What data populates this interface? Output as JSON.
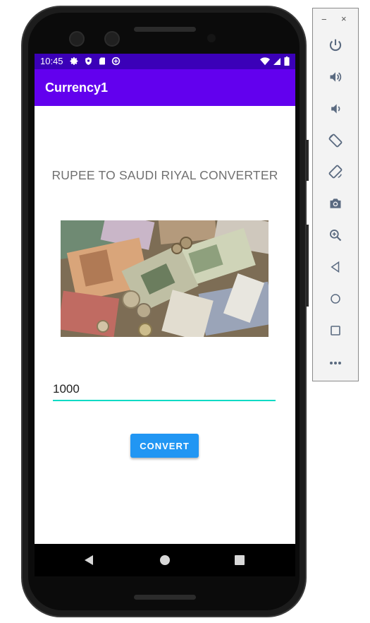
{
  "status_bar": {
    "time": "10:45",
    "left_icons": [
      "settings-icon",
      "shield-icon",
      "sd-card-icon",
      "data-saver-icon"
    ],
    "right_icons": [
      "wifi-icon",
      "signal-icon",
      "battery-icon"
    ]
  },
  "app_bar": {
    "title": "Currency1"
  },
  "main": {
    "heading": "RUPEE TO SAUDI RIYAL CONVERTER",
    "amount_value": "1000",
    "convert_label": "CONVERT",
    "image_name": "currency-notes-image"
  },
  "nav_bar": {
    "buttons": [
      "back-icon",
      "home-icon",
      "recents-icon"
    ]
  },
  "emulator_panel": {
    "minimize_label": "−",
    "close_label": "×",
    "tools": [
      "power-icon",
      "volume-up-icon",
      "volume-down-icon",
      "rotate-left-icon",
      "rotate-right-icon",
      "screenshot-icon",
      "zoom-icon",
      "back-icon",
      "home-icon",
      "overview-icon",
      "more-icon"
    ]
  },
  "colors": {
    "status_bar": "#3b00b8",
    "app_bar": "#6200ee",
    "accent": "#03dac5",
    "button": "#2196f3"
  }
}
